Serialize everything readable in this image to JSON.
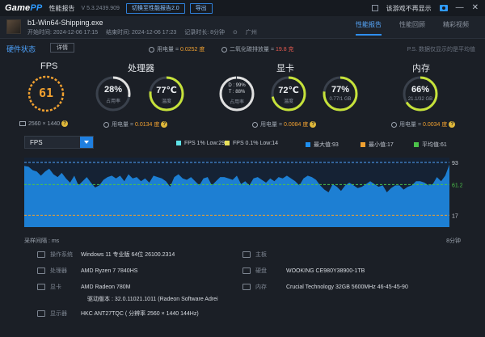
{
  "titlebar": {
    "logo_main": "Game",
    "logo_accent": "PP",
    "app_title": "性能报告",
    "version": "V 5.3.2439.909",
    "switch_button": "切换至性能报告2.0",
    "export_button": "导出",
    "hide_label": "该游戏不再显示"
  },
  "game": {
    "exe": "b1-Win64-Shipping.exe",
    "start_time": "开始时间: 2024-12-06 17:15",
    "end_time": "结束时间: 2024-12-06 17:23",
    "duration": "记录时长: 8分钟",
    "location": "广州"
  },
  "tabs": [
    {
      "label": "性能报告",
      "active": true
    },
    {
      "label": "性能回顾",
      "active": false
    },
    {
      "label": "精彩视频",
      "active": false
    }
  ],
  "hardware": {
    "title": "硬件状态",
    "detail_button": "详情",
    "total_power_label": "用电量 = ",
    "total_power_value": "0.0252 度",
    "co2_label": "二氧化碳排放量 = ",
    "co2_value": "19.8 克",
    "note": "P.S. 数据仅显示的是平均值"
  },
  "fps": {
    "label": "FPS",
    "value": "61",
    "resolution": "2560 × 1440",
    "color": "#f0a030"
  },
  "cpu": {
    "label": "处理器",
    "usage_value": "28%",
    "usage_label": "占用率",
    "temp_value": "77℃",
    "temp_label": "温度",
    "power_label": "用电量 = ",
    "power_value": "0.0134 度",
    "usage_pct": 28,
    "temp_pct": 77
  },
  "gpu": {
    "label": "显卡",
    "d_line": "D : 99%",
    "t_line": "T : 88%",
    "usage_label": "占用率",
    "temp_value": "72℃",
    "temp_label": "温度",
    "vram_value": "77%",
    "vram_sub": "0.77/1 GB",
    "power_label": "用电量 = ",
    "power_value": "0.0084 度",
    "usage_pct": 99,
    "temp_pct": 72,
    "vram_pct": 77
  },
  "memory": {
    "label": "内存",
    "value": "66%",
    "sub": "21.1/32 GB",
    "power_label": "用电量 = ",
    "power_value": "0.0034 度",
    "pct": 66
  },
  "chart_controls": {
    "selected": "FPS",
    "legend": [
      {
        "label": "FPS 1% Low:29",
        "color": "#5fe3e8"
      },
      {
        "label": "FPS 0.1% Low:14",
        "color": "#e8e15a"
      },
      {
        "label": "最大值:93",
        "color": "#1f8ff0"
      },
      {
        "label": "最小值:17",
        "color": "#f0a030"
      },
      {
        "label": "平均值:61",
        "color": "#4cc24a"
      }
    ]
  },
  "chart_data": {
    "type": "area",
    "y_markers": {
      "max": "93",
      "avg": "61.23",
      "min": "17"
    },
    "ylim": [
      0,
      100
    ],
    "values": [
      88,
      87,
      82,
      80,
      74,
      80,
      84,
      76,
      72,
      78,
      70,
      64,
      74,
      60,
      66,
      72,
      64,
      57,
      60,
      68,
      72,
      74,
      70,
      74,
      66,
      76,
      70,
      72,
      66,
      70,
      64,
      74,
      72,
      70,
      66,
      58,
      72,
      76,
      70,
      68,
      72,
      66,
      60,
      70,
      72,
      60,
      66,
      72,
      72,
      70,
      68,
      74,
      62,
      66,
      60,
      70,
      72,
      68,
      64,
      70,
      66,
      72,
      70,
      74,
      70,
      66,
      60,
      70,
      74,
      72,
      68,
      60,
      54,
      50,
      62,
      58,
      52,
      60,
      64,
      60,
      56,
      58,
      62,
      66,
      62,
      58,
      60,
      50,
      56,
      60,
      60,
      54,
      58,
      60,
      66,
      66,
      64,
      60,
      62,
      72,
      66,
      74,
      90
    ],
    "series": [
      {
        "name": "FPS",
        "color": "#1f8ff0"
      }
    ]
  },
  "chart_footer": {
    "left": "采样间隔 : ms",
    "right": "8分钟"
  },
  "specs": {
    "os_label": "操作系统",
    "os_value": "Windows 11 专业版 64位 26100.2314",
    "mb_label": "主板",
    "mb_value": "",
    "cpu_label": "处理器",
    "cpu_value": "AMD Ryzen 7 7840HS",
    "disk_label": "硬盘",
    "disk_value": "WOOKING CE980Y38900-1TB",
    "gpu_label": "显卡",
    "gpu_value": "AMD Radeon 780M",
    "mem_label": "内存",
    "mem_value": "Crucial Technology 32GB 5600MHz 46-45-45-90",
    "driver_value": "驱动版本 : 32.0.11021.1011 (Radeon Software Adrei",
    "display_label": "显示器",
    "display_value": "HKC ANT27TQC ( 分辨率 2560 × 1440 144Hz)"
  }
}
